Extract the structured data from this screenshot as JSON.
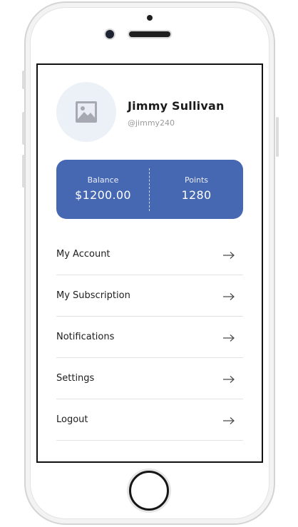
{
  "profile": {
    "name": "Jimmy Sullivan",
    "handle": "@jimmy240",
    "avatar_icon": "image-placeholder-icon"
  },
  "wallet": {
    "balance_label": "Balance",
    "balance_value": "$1200.00",
    "points_label": "Points",
    "points_value": "1280"
  },
  "menu": {
    "items": [
      {
        "label": "My Account",
        "icon": "arrow-right-icon"
      },
      {
        "label": "My Subscription",
        "icon": "arrow-right-icon"
      },
      {
        "label": "Notifications",
        "icon": "arrow-right-icon"
      },
      {
        "label": "Settings",
        "icon": "arrow-right-icon"
      },
      {
        "label": "Logout",
        "icon": "arrow-right-icon"
      }
    ]
  },
  "colors": {
    "accent": "#4667b2",
    "avatar_bg": "#ecf1f8",
    "text_primary": "#1b1b1b",
    "text_muted": "#9a9a9a",
    "divider": "#e2e2e2"
  }
}
